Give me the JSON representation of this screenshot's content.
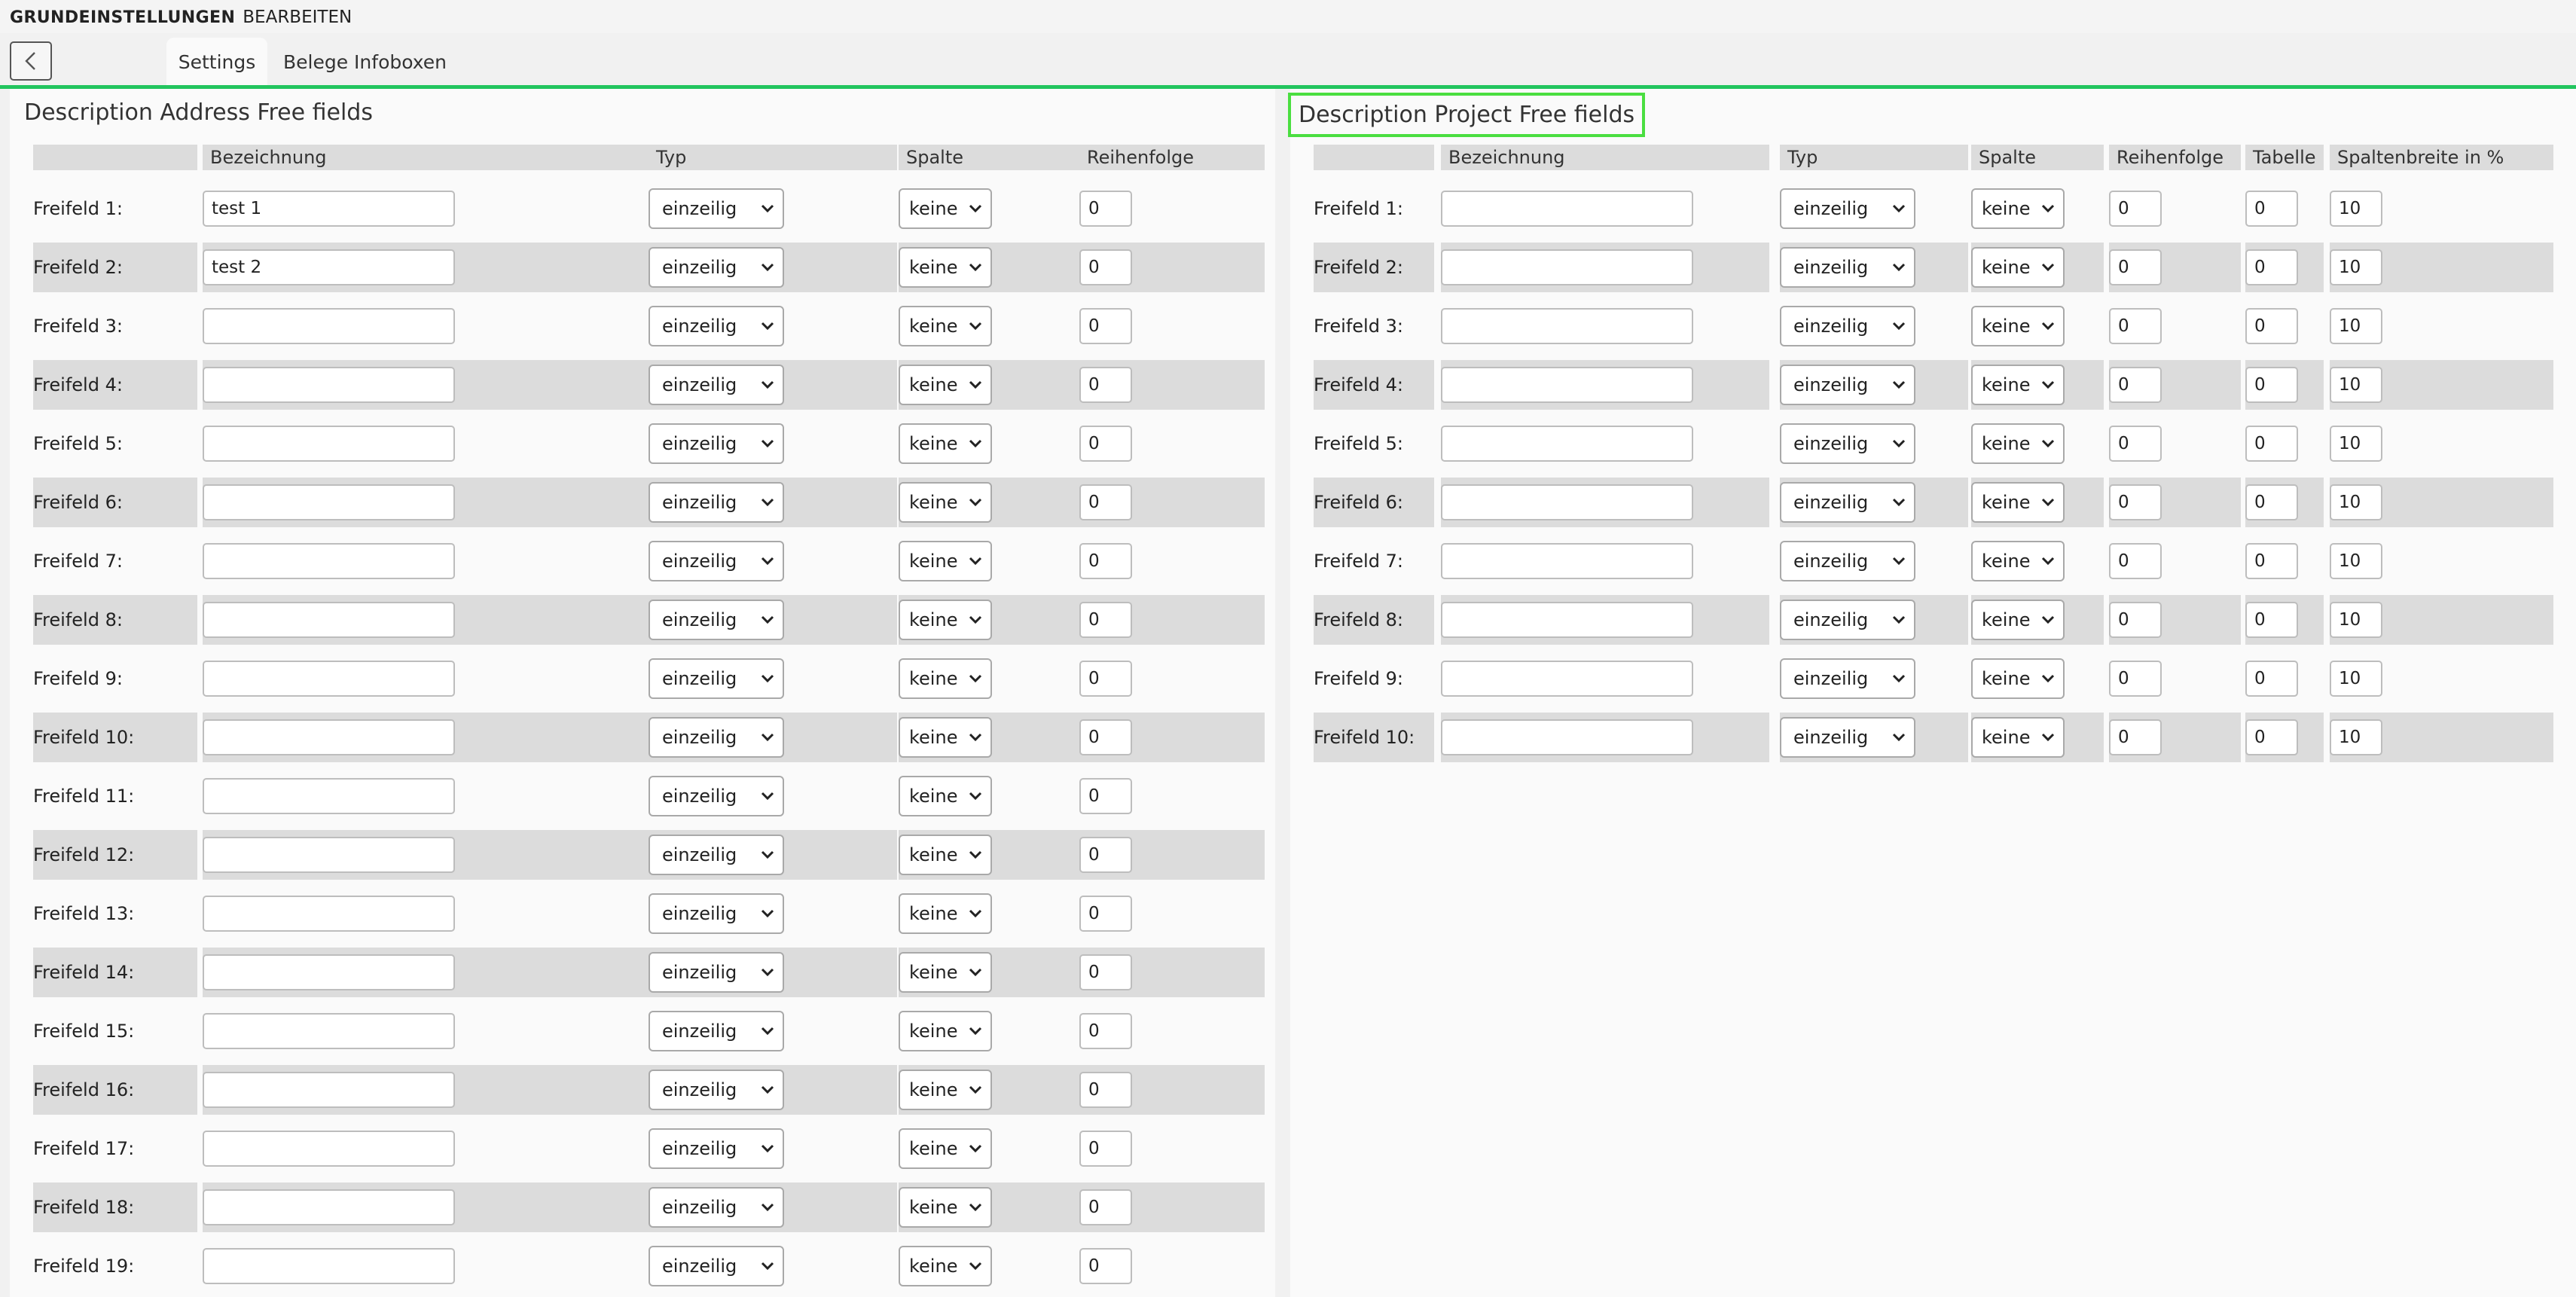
{
  "header": {
    "title_bold": "GRUNDEINSTELLUNGEN",
    "title_sub": "BEARBEITEN"
  },
  "tabs": [
    {
      "label": "Settings"
    },
    {
      "label": "Belege Infoboxen"
    }
  ],
  "icons": {
    "back": "chevron-left-icon",
    "select": "chevron-down-icon"
  },
  "colors": {
    "accent": "#22c55e",
    "highlight": "#4ade40"
  },
  "address": {
    "title": "Description Address Free fields",
    "headers": [
      "",
      "Bezeichnung",
      "Typ",
      "Spalte",
      "Reihenfolge"
    ],
    "rows": [
      {
        "label": "Freifeld 1:",
        "value": "test 1",
        "typ": "einzeilig",
        "spalte": "keine",
        "order": "0"
      },
      {
        "label": "Freifeld 2:",
        "value": "test 2",
        "typ": "einzeilig",
        "spalte": "keine",
        "order": "0"
      },
      {
        "label": "Freifeld 3:",
        "value": "",
        "typ": "einzeilig",
        "spalte": "keine",
        "order": "0"
      },
      {
        "label": "Freifeld 4:",
        "value": "",
        "typ": "einzeilig",
        "spalte": "keine",
        "order": "0"
      },
      {
        "label": "Freifeld 5:",
        "value": "",
        "typ": "einzeilig",
        "spalte": "keine",
        "order": "0"
      },
      {
        "label": "Freifeld 6:",
        "value": "",
        "typ": "einzeilig",
        "spalte": "keine",
        "order": "0"
      },
      {
        "label": "Freifeld 7:",
        "value": "",
        "typ": "einzeilig",
        "spalte": "keine",
        "order": "0"
      },
      {
        "label": "Freifeld 8:",
        "value": "",
        "typ": "einzeilig",
        "spalte": "keine",
        "order": "0"
      },
      {
        "label": "Freifeld 9:",
        "value": "",
        "typ": "einzeilig",
        "spalte": "keine",
        "order": "0"
      },
      {
        "label": "Freifeld 10:",
        "value": "",
        "typ": "einzeilig",
        "spalte": "keine",
        "order": "0"
      },
      {
        "label": "Freifeld 11:",
        "value": "",
        "typ": "einzeilig",
        "spalte": "keine",
        "order": "0"
      },
      {
        "label": "Freifeld 12:",
        "value": "",
        "typ": "einzeilig",
        "spalte": "keine",
        "order": "0"
      },
      {
        "label": "Freifeld 13:",
        "value": "",
        "typ": "einzeilig",
        "spalte": "keine",
        "order": "0"
      },
      {
        "label": "Freifeld 14:",
        "value": "",
        "typ": "einzeilig",
        "spalte": "keine",
        "order": "0"
      },
      {
        "label": "Freifeld 15:",
        "value": "",
        "typ": "einzeilig",
        "spalte": "keine",
        "order": "0"
      },
      {
        "label": "Freifeld 16:",
        "value": "",
        "typ": "einzeilig",
        "spalte": "keine",
        "order": "0"
      },
      {
        "label": "Freifeld 17:",
        "value": "",
        "typ": "einzeilig",
        "spalte": "keine",
        "order": "0"
      },
      {
        "label": "Freifeld 18:",
        "value": "",
        "typ": "einzeilig",
        "spalte": "keine",
        "order": "0"
      },
      {
        "label": "Freifeld 19:",
        "value": "",
        "typ": "einzeilig",
        "spalte": "keine",
        "order": "0"
      }
    ]
  },
  "project": {
    "title": "Description Project Free fields",
    "headers": [
      "",
      "Bezeichnung",
      "Typ",
      "Spalte",
      "Reihenfolge",
      "Tabelle",
      "Spaltenbreite in %"
    ],
    "rows": [
      {
        "label": "Freifeld 1:",
        "value": "",
        "typ": "einzeilig",
        "spalte": "keine",
        "order": "0",
        "tabelle": "0",
        "width": "10"
      },
      {
        "label": "Freifeld 2:",
        "value": "",
        "typ": "einzeilig",
        "spalte": "keine",
        "order": "0",
        "tabelle": "0",
        "width": "10"
      },
      {
        "label": "Freifeld 3:",
        "value": "",
        "typ": "einzeilig",
        "spalte": "keine",
        "order": "0",
        "tabelle": "0",
        "width": "10"
      },
      {
        "label": "Freifeld 4:",
        "value": "",
        "typ": "einzeilig",
        "spalte": "keine",
        "order": "0",
        "tabelle": "0",
        "width": "10"
      },
      {
        "label": "Freifeld 5:",
        "value": "",
        "typ": "einzeilig",
        "spalte": "keine",
        "order": "0",
        "tabelle": "0",
        "width": "10"
      },
      {
        "label": "Freifeld 6:",
        "value": "",
        "typ": "einzeilig",
        "spalte": "keine",
        "order": "0",
        "tabelle": "0",
        "width": "10"
      },
      {
        "label": "Freifeld 7:",
        "value": "",
        "typ": "einzeilig",
        "spalte": "keine",
        "order": "0",
        "tabelle": "0",
        "width": "10"
      },
      {
        "label": "Freifeld 8:",
        "value": "",
        "typ": "einzeilig",
        "spalte": "keine",
        "order": "0",
        "tabelle": "0",
        "width": "10"
      },
      {
        "label": "Freifeld 9:",
        "value": "",
        "typ": "einzeilig",
        "spalte": "keine",
        "order": "0",
        "tabelle": "0",
        "width": "10"
      },
      {
        "label": "Freifeld 10:",
        "value": "",
        "typ": "einzeilig",
        "spalte": "keine",
        "order": "0",
        "tabelle": "0",
        "width": "10"
      }
    ]
  }
}
